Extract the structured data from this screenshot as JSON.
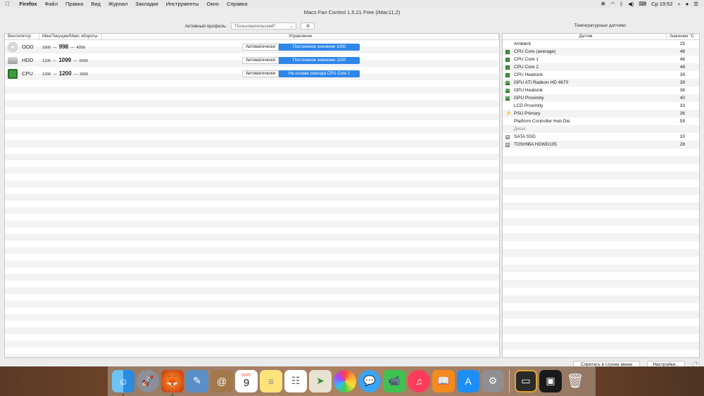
{
  "menubar": {
    "app": "Firefox",
    "items": [
      "Файл",
      "Правка",
      "Вид",
      "Журнал",
      "Закладки",
      "Инструменты",
      "Окно",
      "Справка"
    ],
    "clock": "Ср 19:52"
  },
  "window": {
    "title": "Macs Fan Control 1.5.21 Free (iMac11,2)"
  },
  "toolbar": {
    "profile_label": "Активный профиль:",
    "profile_value": "Пользовательский*"
  },
  "fans": {
    "headers": {
      "fan": "Вентилятор",
      "rpm": "Мин/Текущие/Макс обороты",
      "control": "Управление"
    },
    "auto_label": "Автоматически",
    "rows": [
      {
        "name": "ODD",
        "min": "1000",
        "current": "998",
        "max": "4350",
        "mode": "Постоянное значение 1000",
        "icon": "disc-icon"
      },
      {
        "name": "HDD",
        "min": "1100",
        "current": "1099",
        "max": "6300",
        "mode": "Постоянное значение 1100",
        "icon": "hard-drive-icon"
      },
      {
        "name": "CPU",
        "min": "1200",
        "current": "1200",
        "max": "2600",
        "mode": "На основе сенсора CPU Core 1",
        "icon": "chip-icon"
      }
    ]
  },
  "sensors": {
    "title": "Температурные датчики:",
    "headers": {
      "sensor": "Датчик",
      "value": "Значение °C"
    },
    "rows": [
      {
        "name": "Ambient",
        "value": "25",
        "icon": "none"
      },
      {
        "name": "CPU Core (average)",
        "value": "48",
        "icon": "chip-icon"
      },
      {
        "name": "CPU Core 1",
        "value": "48",
        "icon": "chip-icon"
      },
      {
        "name": "CPU Core 2",
        "value": "48",
        "icon": "chip-icon"
      },
      {
        "name": "CPU Heatsink",
        "value": "39",
        "icon": "chip-icon"
      },
      {
        "name": "GPU ATI Radeon HD 4670",
        "value": "39",
        "icon": "gpu-icon"
      },
      {
        "name": "GPU Heatsink",
        "value": "36",
        "icon": "gpu-icon"
      },
      {
        "name": "GPU Proximity",
        "value": "40",
        "icon": "gpu-icon"
      },
      {
        "name": "LCD Proximity",
        "value": "33",
        "icon": "none"
      },
      {
        "name": "PSU Primary",
        "value": "36",
        "icon": "lightning-icon"
      },
      {
        "name": "Platform Controller Hub Die",
        "value": "59",
        "icon": "none"
      }
    ],
    "disks_group": "Диски:",
    "disks": [
      {
        "name": "SATA SSD",
        "value": "33",
        "icon": "disk-icon"
      },
      {
        "name": "TOSHIBA HDWD105",
        "value": "28",
        "icon": "disk-icon"
      }
    ]
  },
  "footer": {
    "hide_button": "Спрятать в строке меню",
    "settings_button": "Настройки...",
    "help": "?"
  },
  "dock": {
    "calendar_month": "СЕНТ.",
    "calendar_day": "9"
  },
  "colors": {
    "accent": "#2f86e8",
    "chip_green": "#3c9a3c"
  }
}
